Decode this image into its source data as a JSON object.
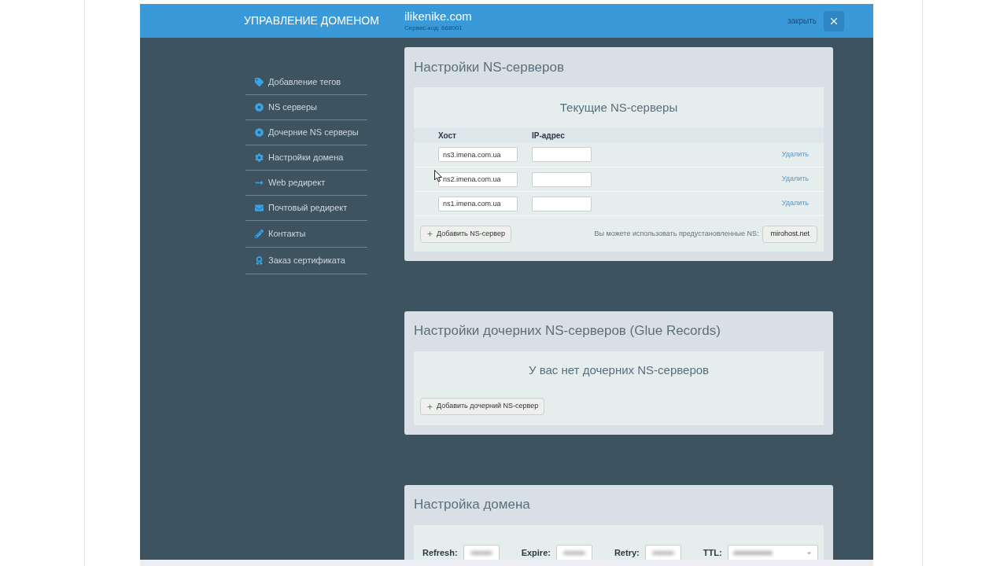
{
  "header": {
    "title": "УПРАВЛЕНИЕ ДОМЕНОМ",
    "domain": "ilikenike.com",
    "service_code": "Сервис-код: 668001",
    "close_label": "закрыть"
  },
  "sidebar": {
    "items": [
      {
        "label": "Добавление тегов"
      },
      {
        "label": "NS серверы"
      },
      {
        "label": "Дочерние NS серверы"
      },
      {
        "label": "Настройки домена"
      },
      {
        "label": "Web редирект"
      },
      {
        "label": "Почтовый редирект"
      },
      {
        "label": "Контакты"
      },
      {
        "label": "Заказ сертификата"
      }
    ]
  },
  "ns_servers": {
    "title": "Настройки NS-серверов",
    "subtitle": "Текущие NS-серверы",
    "columns": [
      "Хост",
      "IP-адрес"
    ],
    "rows": [
      {
        "host": "ns3.imena.com.ua",
        "action": "Удалить"
      },
      {
        "host": "ns2.imena.com.ua",
        "action": "Удалить"
      },
      {
        "host": "ns1.imena.com.ua",
        "action": "Удалить"
      }
    ],
    "add_button": "Добавить NS-сервер",
    "hint": "Вы можете использовать предустановленные NS:",
    "preset_button": "mirohost.net"
  },
  "glue_records": {
    "title": "Настройки дочерних NS-серверов (Glue Records)",
    "empty_message": "У вас нет дочерних NS-серверов",
    "add_button": "Добавить дочерний NS-сервер"
  },
  "domain_settings": {
    "title": "Настройка домена",
    "fields": [
      {
        "label": "Refresh:",
        "kind": "input"
      },
      {
        "label": "Expire:",
        "kind": "input"
      },
      {
        "label": "Retry:",
        "kind": "input"
      },
      {
        "label": "TTL:",
        "kind": "select"
      }
    ]
  }
}
